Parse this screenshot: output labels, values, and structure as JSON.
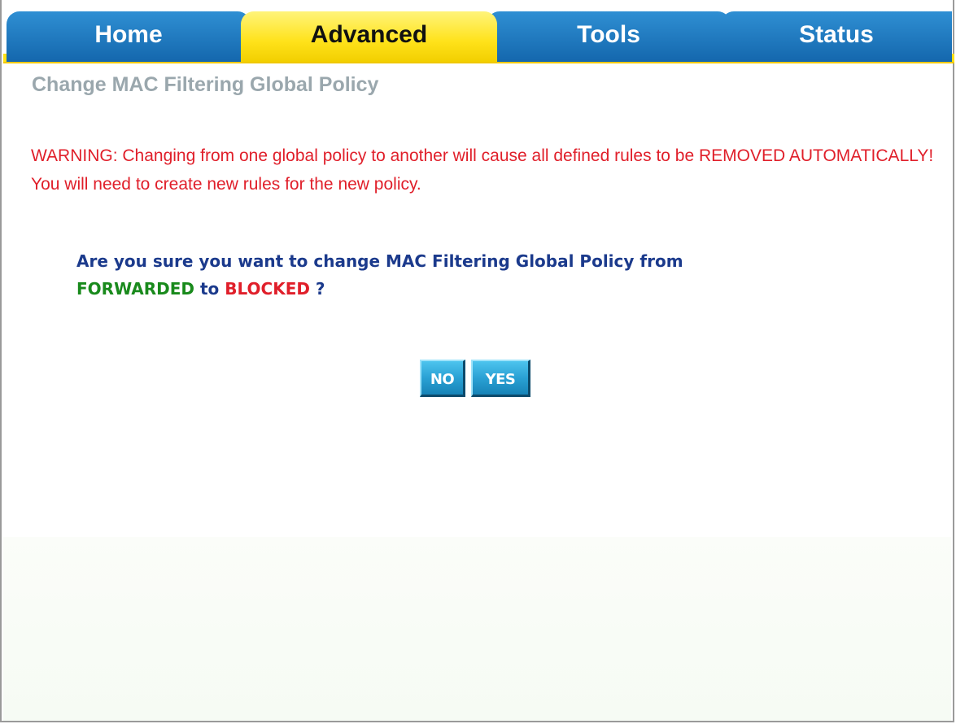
{
  "tabs": [
    {
      "label": "Home",
      "active": false
    },
    {
      "label": "Advanced",
      "active": true
    },
    {
      "label": "Tools",
      "active": false
    },
    {
      "label": "Status",
      "active": false
    }
  ],
  "page": {
    "title": "Change MAC Filtering Global Policy",
    "warning": "WARNING: Changing from one global policy to another will cause all defined rules to be REMOVED AUTOMATICALLY! You will need to create new rules for the new policy."
  },
  "question": {
    "prefix": "Are you sure you want to change MAC Filtering Global Policy from",
    "from_policy": "FORWARDED",
    "connector": "to",
    "to_policy": "BLOCKED",
    "suffix": "?"
  },
  "buttons": {
    "no_label": "NO",
    "yes_label": "YES"
  },
  "colors": {
    "tab_blue": "#1f7cc2",
    "tab_active_yellow": "#ffe21a",
    "title_gray": "#9aa7ad",
    "warning_red": "#e01f2a",
    "question_blue": "#1b3a8c",
    "forwarded_green": "#198a1c",
    "blocked_red": "#e01f2a",
    "button_cyan": "#2aa1d4"
  }
}
